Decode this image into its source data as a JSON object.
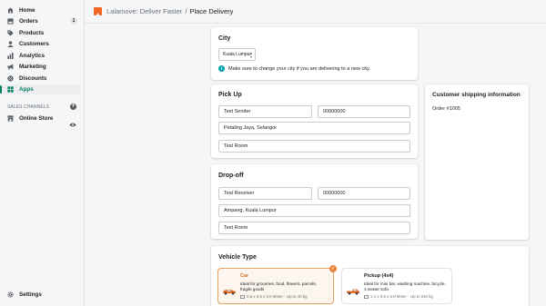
{
  "sidebar": {
    "items": [
      {
        "label": "Home",
        "icon": "home-icon"
      },
      {
        "label": "Orders",
        "icon": "orders-icon",
        "badge": "1"
      },
      {
        "label": "Products",
        "icon": "tag-icon"
      },
      {
        "label": "Customers",
        "icon": "person-icon"
      },
      {
        "label": "Analytics",
        "icon": "bar-chart-icon"
      },
      {
        "label": "Marketing",
        "icon": "megaphone-icon"
      },
      {
        "label": "Discounts",
        "icon": "discount-icon"
      },
      {
        "label": "Apps",
        "icon": "apps-icon"
      }
    ],
    "sales_channels_label": "SALES CHANNELS",
    "online_store_label": "Online Store",
    "settings_label": "Settings"
  },
  "header": {
    "app_name": "Lalamove: Deliver Faster",
    "separator": "/",
    "page_title": "Place Delivery"
  },
  "city": {
    "title": "City",
    "selected": "Kuala Lumpur",
    "info": "Make sure to change your city if you are delivering to a new city."
  },
  "pickup": {
    "title": "Pick Up",
    "name": "Test Sender",
    "phone": "00000000",
    "address": "Petaling Jaya, Selangor",
    "room": "Test Room"
  },
  "dropoff": {
    "title": "Drop-off",
    "name": "Test Receiver",
    "phone": "00000000",
    "address": "Ampang, Kuala Lumpur",
    "room": "Test Room"
  },
  "customer": {
    "title": "Customer shipping information",
    "order": "Order #1005"
  },
  "vehicle": {
    "title": "Vehicle Type",
    "options": [
      {
        "name": "Car",
        "desc": "Ideal for groceries, food, flowers, parcels, fragile goods",
        "spec": "0.5 x 0.5 x 0.5 Meter · Up to 40 kg",
        "selected": true
      },
      {
        "name": "Pickup (4x4)",
        "desc": "Ideal for mini bar, washing machine, bicycle, 1-seater sofa",
        "spec": "1.2 x 0.8 x 0.8 Meter · Up to 250 kg",
        "selected": false
      }
    ]
  },
  "colors": {
    "accent_green": "#008060",
    "lalamove_orange": "#f16622",
    "selected_border": "#e8a25e"
  }
}
